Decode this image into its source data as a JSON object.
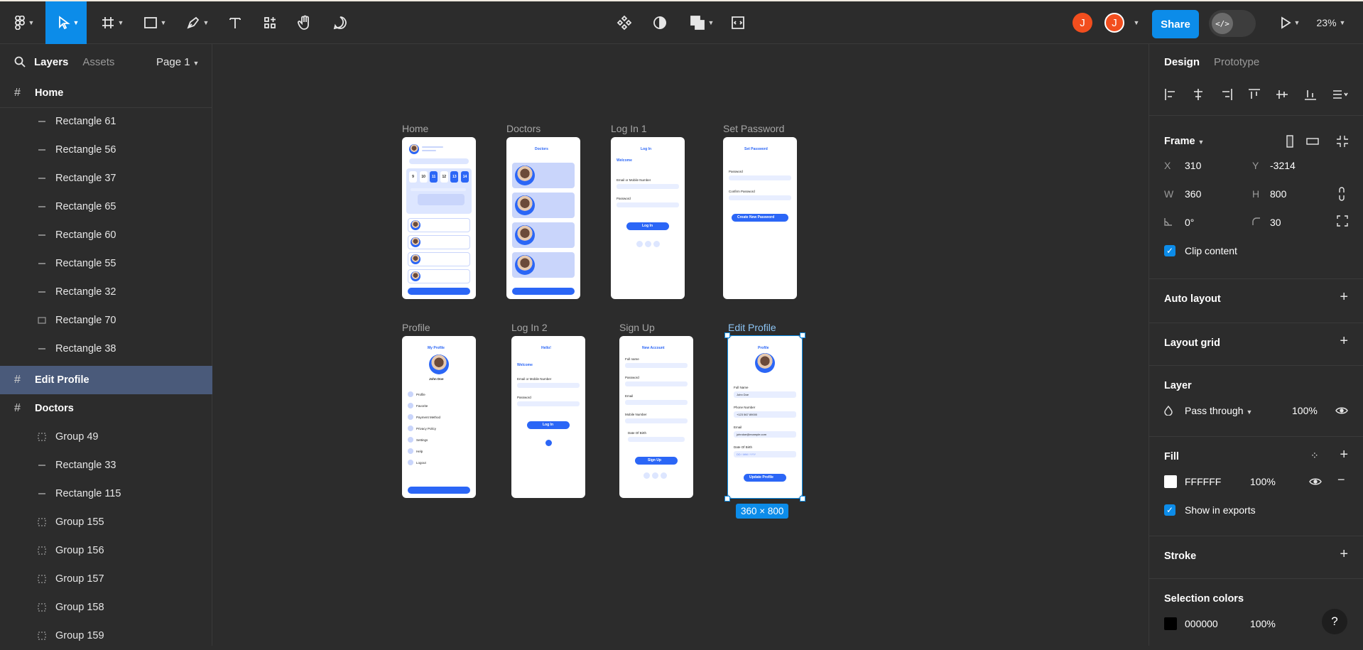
{
  "toolbar": {
    "zoom": "23%",
    "share_label": "Share",
    "avatar1": "J",
    "avatar2": "J",
    "dev_mode_label": "</>"
  },
  "left_panel": {
    "tabs": {
      "layers": "Layers",
      "assets": "Assets"
    },
    "page": "Page 1",
    "home_frame": "Home",
    "home_children": [
      "Rectangle 61",
      "Rectangle 56",
      "Rectangle 37",
      "Rectangle 65",
      "Rectangle 60",
      "Rectangle 55",
      "Rectangle 32",
      "Rectangle 70",
      "Rectangle 38"
    ],
    "edit_profile_frame": "Edit Profile",
    "doctors_frame": "Doctors",
    "doctors_children": [
      "Group 49",
      "Rectangle 33",
      "Rectangle 115",
      "Group 155",
      "Group 156",
      "Group 157",
      "Group 158",
      "Group 159"
    ]
  },
  "canvas": {
    "frames": {
      "home": "Home",
      "doctors": "Doctors",
      "login1": "Log In 1",
      "set_password": "Set Password",
      "profile": "Profile",
      "login2": "Log In 2",
      "signup": "Sign Up",
      "edit_profile": "Edit Profile"
    },
    "size_tag": "360 × 800",
    "mock": {
      "doctors_title": "Doctors",
      "login_title": "Log In",
      "welcome": "Welcome",
      "email_label": "Email or Mobile Number",
      "password_label": "Password",
      "login_btn": "Log In",
      "set_password_title": "Set Password",
      "confirm_password": "Confirm Password",
      "create_password_btn": "Create New Password",
      "my_profile": "My Profile",
      "profile_name": "John Doe",
      "profile_menu": [
        "Profile",
        "Favorite",
        "Payment Method",
        "Privacy Policy",
        "Settings",
        "Help",
        "Logout"
      ],
      "hello": "Hello!",
      "new_account": "New Account",
      "full_name": "Full name",
      "email": "Email",
      "mobile": "Mobile Number",
      "dob": "Date Of Birth",
      "signup_btn": "Sign Up",
      "profile_title": "Profile",
      "ep_full_name": "Full Name",
      "ep_full_name_val": "John Doe",
      "ep_phone": "Phone Number",
      "ep_phone_val": "+123 567 89000",
      "ep_email": "Email",
      "ep_email_val": "johndoe@example.com",
      "ep_dob": "Date Of Birth",
      "ep_dob_val": "DD / MM / YYY",
      "update_btn": "Update Profile",
      "home_dates": [
        "9",
        "10",
        "11",
        "12",
        "13",
        "14"
      ]
    }
  },
  "right_panel": {
    "tabs": {
      "design": "Design",
      "prototype": "Prototype"
    },
    "frame_label": "Frame",
    "x_label": "X",
    "x": "310",
    "y_label": "Y",
    "y": "-3214",
    "w_label": "W",
    "w": "360",
    "h_label": "H",
    "h": "800",
    "rotation": "0°",
    "radius": "30",
    "clip_content": "Clip content",
    "auto_layout": "Auto layout",
    "layout_grid": "Layout grid",
    "layer": "Layer",
    "blend": "Pass through",
    "layer_opacity": "100%",
    "fill": "Fill",
    "fill_hex": "FFFFFF",
    "fill_opacity": "100%",
    "show_in_exports": "Show in exports",
    "stroke": "Stroke",
    "selection_colors": "Selection colors",
    "sel_color_hex": "000000",
    "sel_color_opacity": "100%",
    "help": "?"
  },
  "colors": {
    "accent": "#0c8ce9",
    "brand_blue": "#2b66f6",
    "avatar": "#f24e1e"
  },
  "icons": [
    "figma-menu-icon",
    "move-tool-icon",
    "frame-tool-icon",
    "rectangle-tool-icon",
    "pen-tool-icon",
    "text-tool-icon",
    "resources-icon",
    "hand-tool-icon",
    "comment-icon",
    "component-icon",
    "contrast-icon",
    "boolean-icon",
    "crop-icon",
    "play-icon",
    "search-icon"
  ]
}
